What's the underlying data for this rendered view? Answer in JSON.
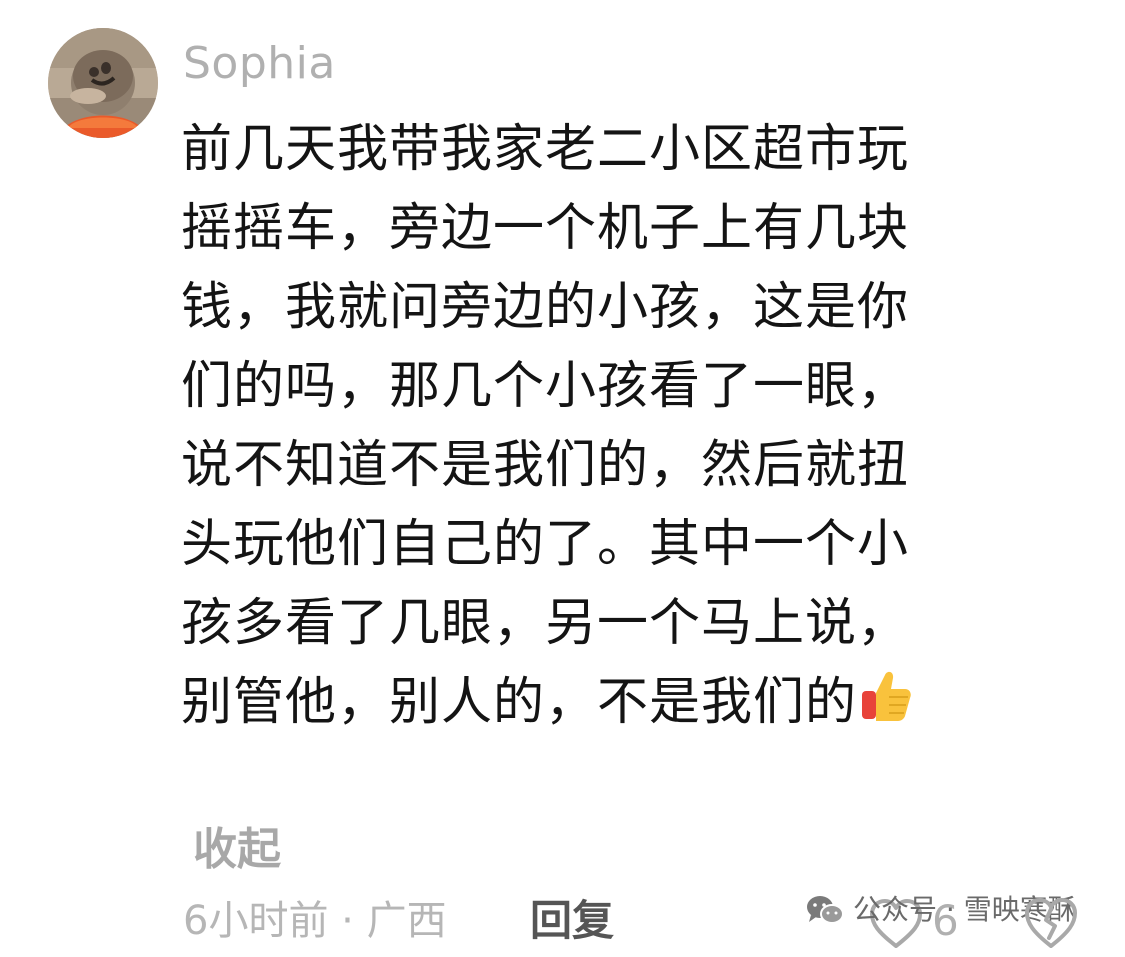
{
  "comment": {
    "username": "Sophia",
    "avatar_icon": "avatar-image",
    "lines": [
      "前几天我带我家老二小区超市玩",
      "摇摇车，旁边一个机子上有几块",
      "钱，我就问旁边的小孩，这是你",
      "们的吗，那几个小孩看了一眼，",
      "说不知道不是我们的，然后就扭",
      "头玩他们自己的了。其中一个小",
      "孩多看了几眼，另一个马上说，",
      "别管他，别人的，不是我们的"
    ],
    "emoji_icon": "thumbs-up-emoji",
    "collapse_label": "收起",
    "time_location": "6小时前 · 广西",
    "reply_label": "回复",
    "like_count": "6",
    "like_icon": "heart-icon",
    "dislike_icon": "broken-heart-icon"
  },
  "watermark": {
    "icon": "wechat-icon",
    "text": "公众号 · 雪映寒酥"
  },
  "colors": {
    "text": "#141414",
    "muted": "#b0b0b0",
    "reply": "#555555"
  }
}
